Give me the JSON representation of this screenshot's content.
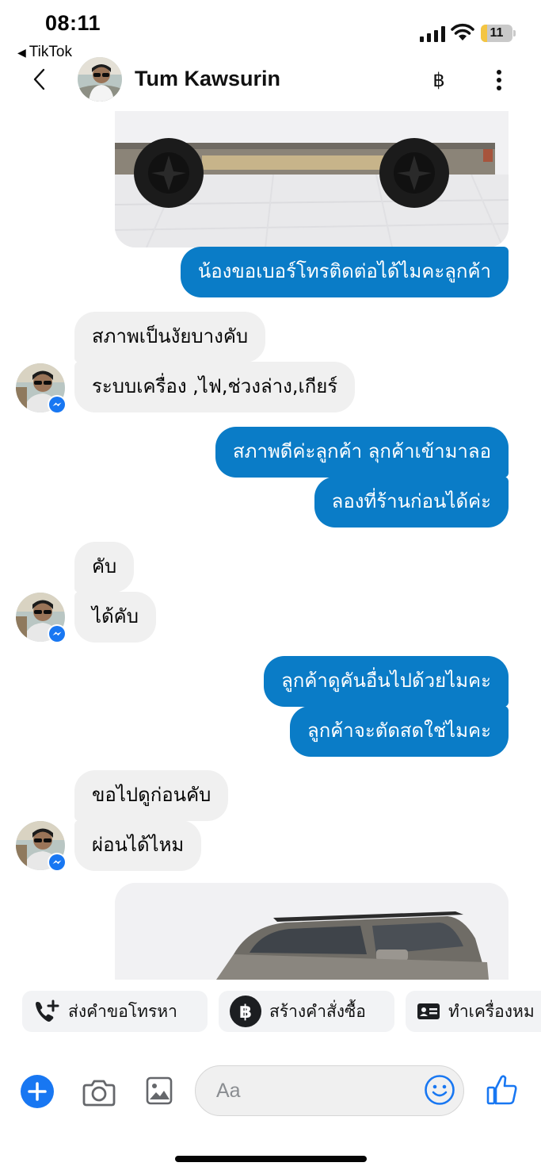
{
  "status_bar": {
    "time": "08:11",
    "back_app": "TikTok",
    "battery_level": "11",
    "battery_fraction": 0.11
  },
  "header": {
    "contact_name": "Tum Kawsurin",
    "baht_symbol": "฿"
  },
  "messages": [
    {
      "type": "image",
      "side": "out",
      "content": "pickup-truck-side"
    },
    {
      "side": "out",
      "text": "น้องขอเบอร์โทรติดต่อได้ไมคะลูกค้า"
    },
    {
      "side": "in",
      "text": "สภาพเป็นงัยบางคับ"
    },
    {
      "side": "in",
      "text": "ระบบเครื่อง ,ไฟ,ช่วงล่าง,เกียร์"
    },
    {
      "side": "out",
      "text": "สภาพดีค่ะลูกค้า  ลุกค้าเข้ามาลอ"
    },
    {
      "side": "out",
      "text": "ลองที่ร้านก่อนได้ค่ะ"
    },
    {
      "side": "in",
      "text": "คับ"
    },
    {
      "side": "in",
      "text": "ได้คับ"
    },
    {
      "side": "out",
      "text": "ลูกค้าดูคันอื่นไปด้วยไมคะ"
    },
    {
      "side": "out",
      "text": "ลูกค้าจะตัดสดใช่ไมคะ"
    },
    {
      "side": "in",
      "text": "ขอไปดูก่อนคับ"
    },
    {
      "side": "in",
      "text": "ผ่อนได้ไหม"
    },
    {
      "type": "image",
      "side": "out",
      "content": "pickup-truck-front"
    }
  ],
  "quick_actions": [
    {
      "label": "ส่งคำขอโทรหา",
      "icon": "phone-plus-icon"
    },
    {
      "label": "สร้างคำสั่งซื้อ",
      "icon": "baht-circle-icon"
    },
    {
      "label": "ทำเครื่องหม",
      "icon": "id-card-icon"
    }
  ],
  "composer": {
    "placeholder": "Aa"
  },
  "colors": {
    "outgoing_bubble": "#0a7cc7",
    "incoming_bubble": "#f0f0f0",
    "messenger_blue": "#1877f2",
    "battery_fill": "#f4c542"
  }
}
